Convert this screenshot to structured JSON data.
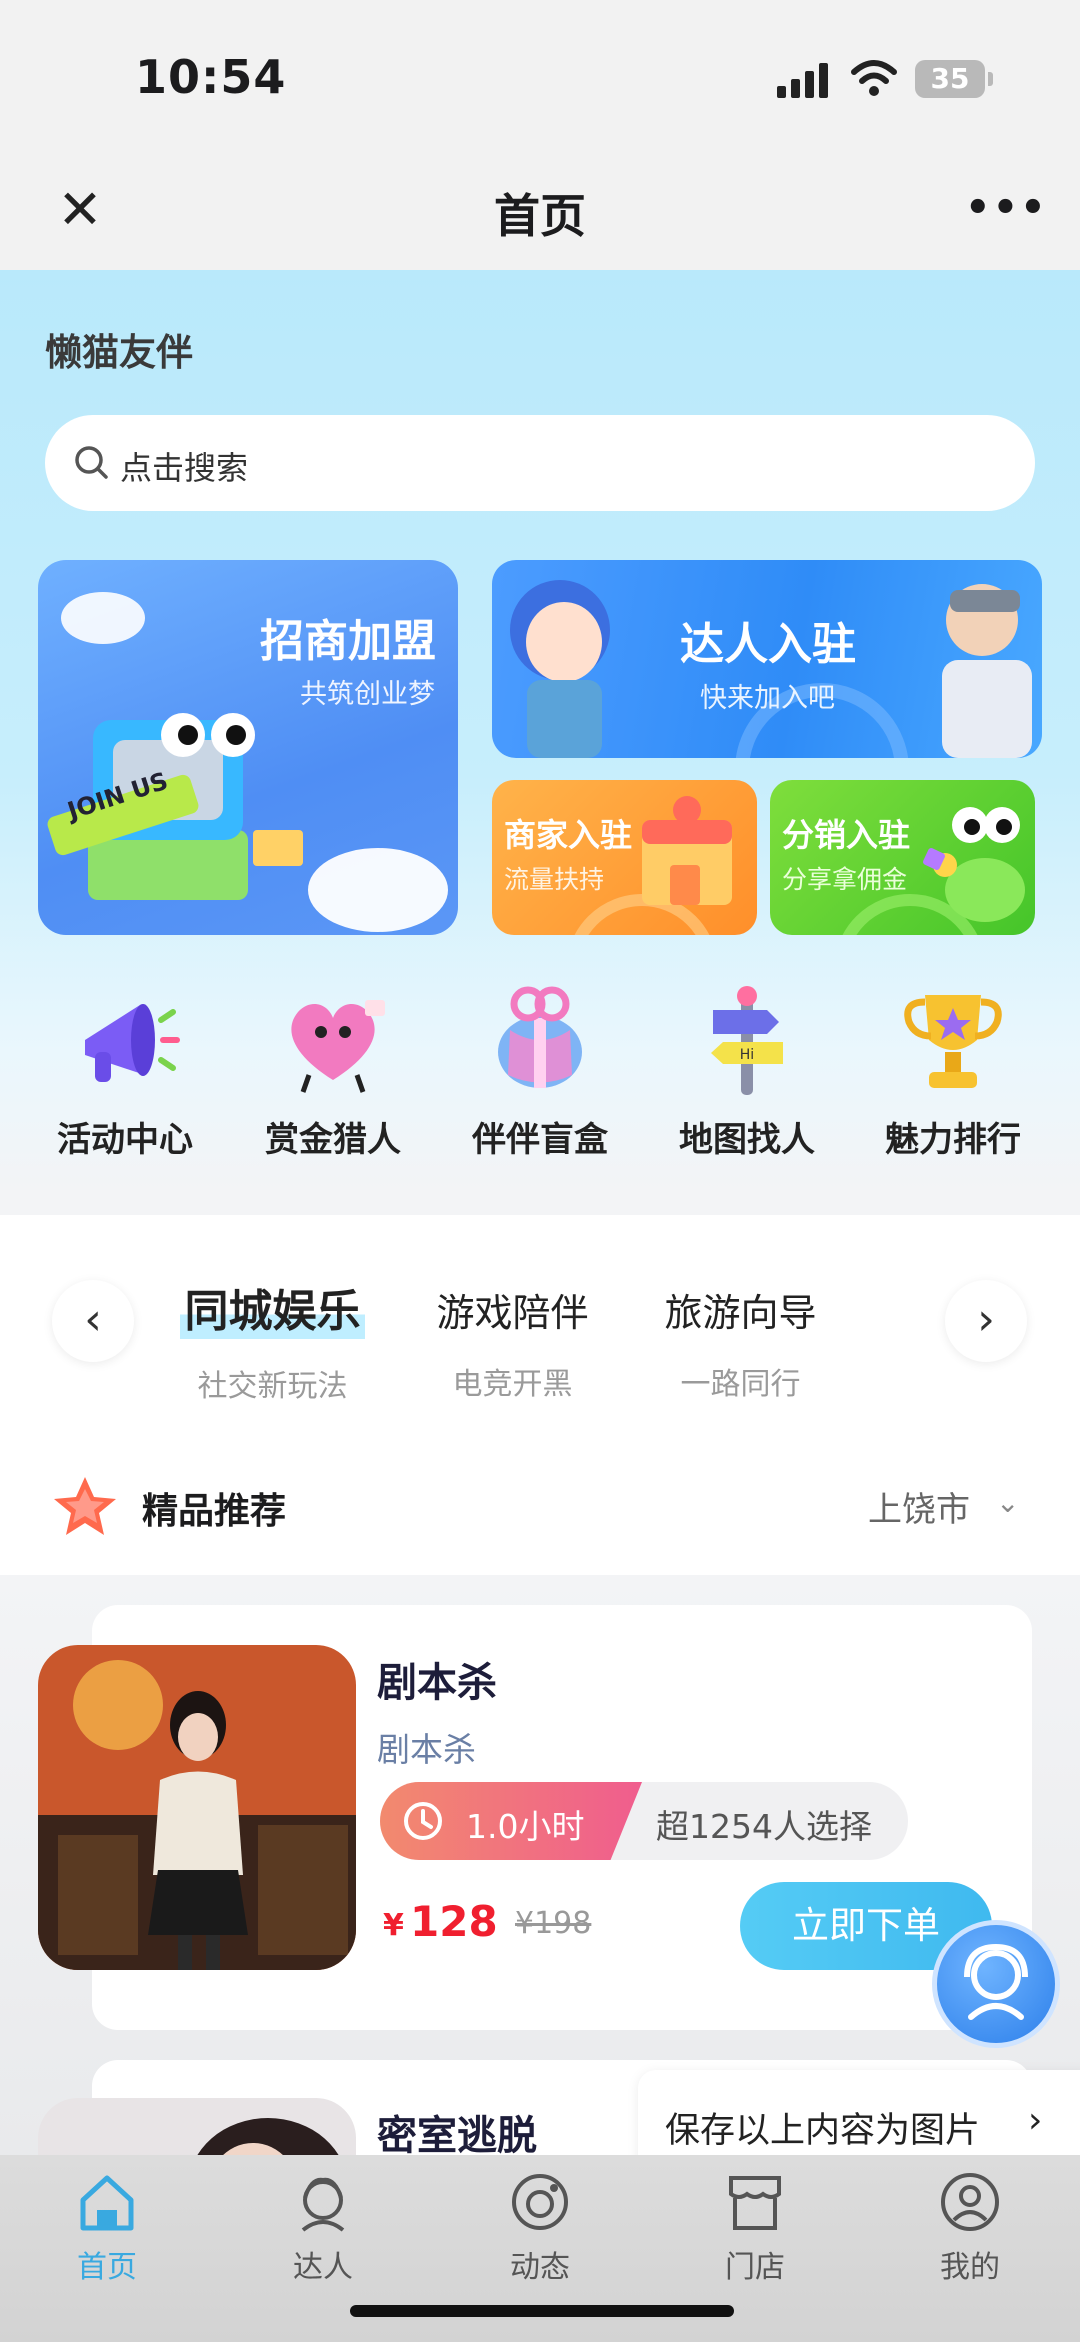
{
  "status_bar": {
    "time": "10:54",
    "battery": "35"
  },
  "nav": {
    "title": "首页",
    "close_icon": "close-icon",
    "more_icon": "more-icon"
  },
  "app": {
    "name": "懒猫友伴"
  },
  "search": {
    "placeholder": "点击搜索"
  },
  "banners": {
    "merchant": {
      "title": "招商加盟",
      "subtitle": "共筑创业梦",
      "badge": "JOIN US"
    },
    "talent": {
      "title": "达人入驻",
      "subtitle": "快来加入吧"
    },
    "shop": {
      "title": "商家入驻",
      "subtitle": "流量扶持"
    },
    "distribution": {
      "title": "分销入驻",
      "subtitle": "分享拿佣金"
    }
  },
  "menu": [
    {
      "label": "活动中心",
      "icon": "megaphone-icon"
    },
    {
      "label": "赏金猎人",
      "icon": "heart-character-icon"
    },
    {
      "label": "伴伴盲盒",
      "icon": "gift-box-icon"
    },
    {
      "label": "地图找人",
      "icon": "signpost-icon"
    },
    {
      "label": "魅力排行",
      "icon": "trophy-icon"
    }
  ],
  "category_tabs": [
    {
      "label": "同城娱乐",
      "sub": "社交新玩法",
      "active": true
    },
    {
      "label": "游戏陪伴",
      "sub": "电竞开黑",
      "active": false
    },
    {
      "label": "旅游向导",
      "sub": "一路同行",
      "active": false
    }
  ],
  "recommend": {
    "title": "精品推荐",
    "city": "上饶市"
  },
  "products": [
    {
      "name": "剧本杀",
      "category": "剧本杀",
      "duration": "1.0小时",
      "popularity": "超1254人选择",
      "currency": "¥",
      "price": "128",
      "original_price": "¥198",
      "order_label": "立即下单"
    },
    {
      "name": "密室逃脱"
    }
  ],
  "save_prompt": {
    "text": "保存以上内容为图片",
    "chevron": "›"
  },
  "tab_bar": [
    {
      "label": "首页",
      "icon": "home-icon",
      "active": true
    },
    {
      "label": "达人",
      "icon": "person-icon",
      "active": false
    },
    {
      "label": "动态",
      "icon": "moments-icon",
      "active": false
    },
    {
      "label": "门店",
      "icon": "store-icon",
      "active": false
    },
    {
      "label": "我的",
      "icon": "profile-icon",
      "active": false
    }
  ],
  "colors": {
    "accent": "#39a9e0",
    "price": "#f01f2f",
    "order_button": "#4cc3f3"
  }
}
